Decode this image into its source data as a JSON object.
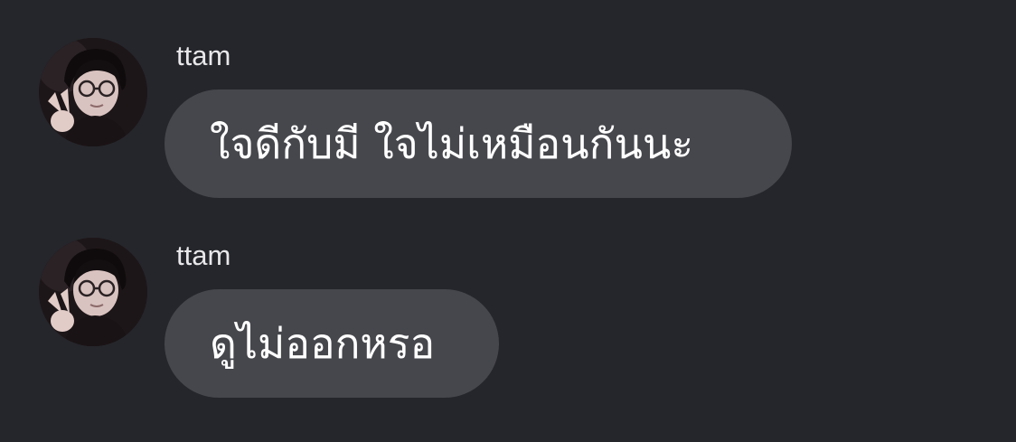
{
  "theme": {
    "background": "#25262b",
    "bubble": "#46474c",
    "text": "#ffffff",
    "username": "#e8e8ea"
  },
  "messages": [
    {
      "username": "ttam",
      "text": "ใจดีกับมี ใจไม่เหมือนกันนะ",
      "avatar_icon": "user-avatar-photo"
    },
    {
      "username": "ttam",
      "text": "ดูไม่ออกหรอ",
      "avatar_icon": "user-avatar-photo"
    }
  ]
}
